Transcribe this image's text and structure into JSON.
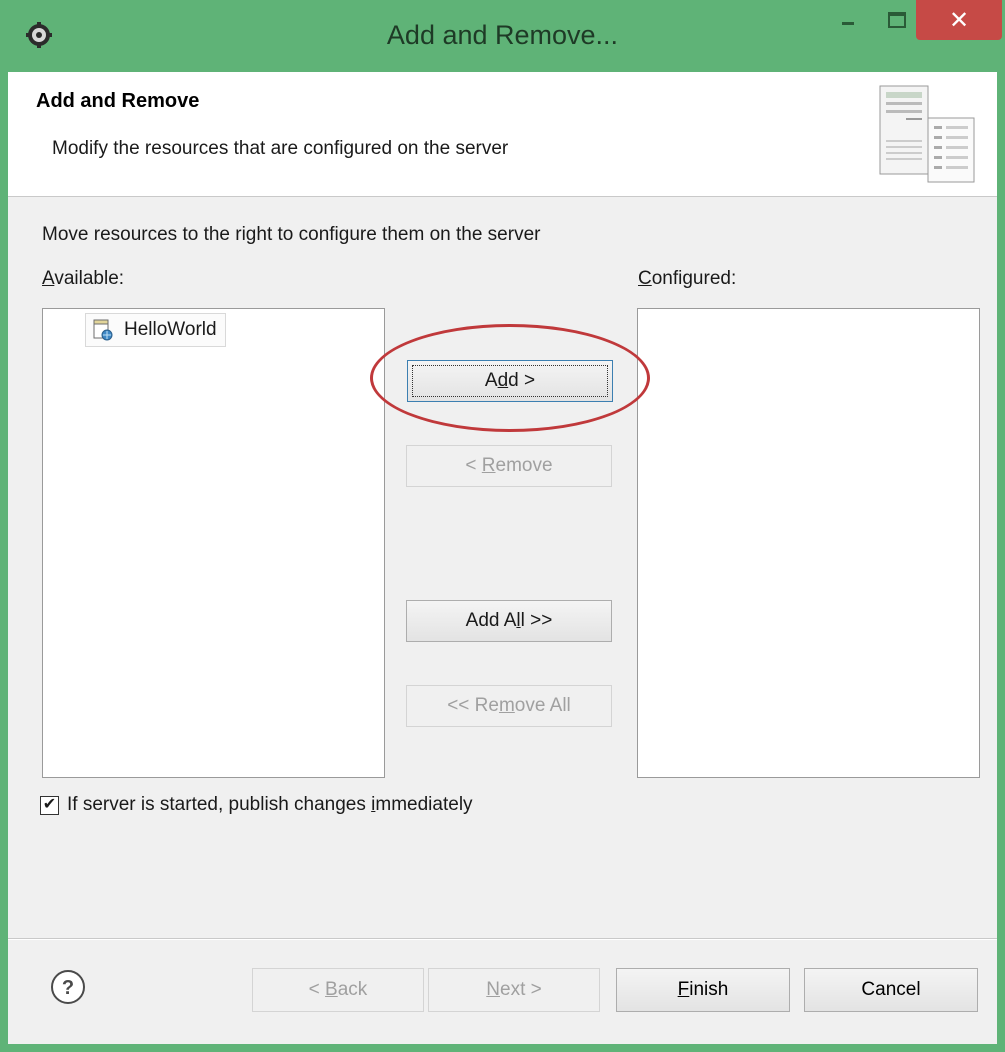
{
  "window": {
    "title": "Add and Remove...",
    "close_glyph": "✕"
  },
  "banner": {
    "title": "Add and Remove",
    "description": "Modify the resources that are configured on the server",
    "icon": "server-config-icon"
  },
  "main": {
    "instruction": "Move resources to the right to configure them on the server",
    "available_label": {
      "before": "",
      "mnemonic": "A",
      "after": "vailable:"
    },
    "configured_label": {
      "before": "",
      "mnemonic": "C",
      "after": "onfigured:"
    },
    "available_items": [
      {
        "label": "HelloWorld",
        "icon": "web-project-icon"
      }
    ],
    "configured_items": []
  },
  "buttons": {
    "add": {
      "before": "A",
      "mnemonic": "d",
      "after": "d >",
      "enabled": true,
      "highlighted": true
    },
    "remove": {
      "before": "< ",
      "mnemonic": "R",
      "after": "emove",
      "enabled": false
    },
    "add_all": {
      "before": "Add A",
      "mnemonic": "l",
      "after": "l >>",
      "enabled": true
    },
    "remove_all": {
      "before": "<< Re",
      "mnemonic": "m",
      "after": "ove All",
      "enabled": false
    }
  },
  "publish_option": {
    "checked": true,
    "check_glyph": "✔",
    "before": "If server is started, publish changes ",
    "mnemonic": "i",
    "after": "mmediately"
  },
  "footer": {
    "help_icon": "help-icon",
    "back": {
      "before": "< ",
      "mnemonic": "B",
      "after": "ack",
      "enabled": false
    },
    "next": {
      "before": "",
      "mnemonic": "N",
      "after": "ext >",
      "enabled": false
    },
    "finish": {
      "before": "",
      "mnemonic": "F",
      "after": "inish",
      "enabled": true
    },
    "cancel": {
      "label": "Cancel",
      "enabled": true
    }
  },
  "colors": {
    "titlebar": "#5fb377",
    "close_button": "#c64a46",
    "highlight_ring": "#c0393b",
    "dialog_background": "#f0f0f0"
  }
}
